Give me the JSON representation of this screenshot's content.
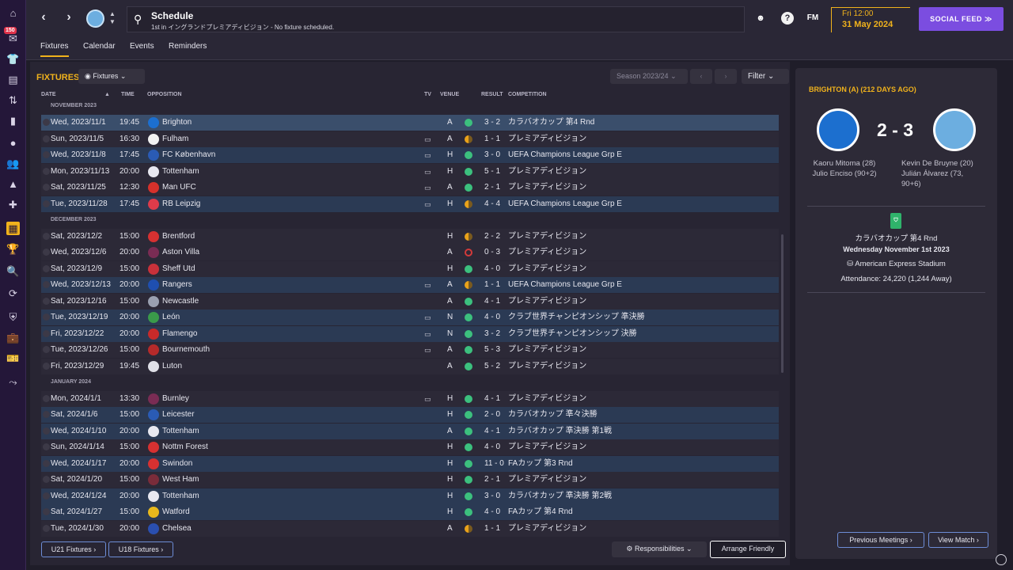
{
  "rail": {
    "badge": "150"
  },
  "header": {
    "title": "Schedule",
    "subtitle": "1st in イングランドプレミアディビジョン - No fixture scheduled.",
    "brand": "FM",
    "date_day": "Fri 12:00",
    "date_full": "31 May 2024",
    "social_feed": "SOCIAL FEED ≫"
  },
  "tabs": [
    "Fixtures",
    "Calendar",
    "Events",
    "Reminders"
  ],
  "fixtures": {
    "heading": "FIXTURES",
    "view_select": "Fixtures",
    "season": "Season 2023/24",
    "filter": "Filter",
    "columns": {
      "date": "DATE",
      "time": "TIME",
      "opposition": "OPPOSITION",
      "tv": "TV",
      "venue": "VENUE",
      "result": "RESULT",
      "competition": "COMPETITION"
    },
    "months": [
      {
        "label": "NOVEMBER 2023",
        "rows": [
          {
            "date": "Wed, 2023/11/1",
            "time": "19:45",
            "opp": "Brighton",
            "tv": false,
            "venue": "A",
            "outcome": "w",
            "score": "3 - 2",
            "comp": "カラバオカップ 第4 Rnd",
            "style": "hl",
            "crest": "#1c6fcf"
          },
          {
            "date": "Sun, 2023/11/5",
            "time": "16:30",
            "opp": "Fulham",
            "tv": true,
            "venue": "A",
            "outcome": "d",
            "score": "1 - 1",
            "comp": "プレミアディビジョン",
            "style": "",
            "crest": "#f2f2f2"
          },
          {
            "date": "Wed, 2023/11/8",
            "time": "17:45",
            "opp": "FC København",
            "tv": true,
            "venue": "H",
            "outcome": "w",
            "score": "3 - 0",
            "comp": "UEFA Champions League Grp E",
            "style": "cup",
            "crest": "#2a5bb5"
          },
          {
            "date": "Mon, 2023/11/13",
            "time": "20:00",
            "opp": "Tottenham",
            "tv": true,
            "venue": "H",
            "outcome": "w",
            "score": "5 - 1",
            "comp": "プレミアディビジョン",
            "style": "",
            "crest": "#e8e8f0"
          },
          {
            "date": "Sat, 2023/11/25",
            "time": "12:30",
            "opp": "Man UFC",
            "tv": true,
            "venue": "A",
            "outcome": "w",
            "score": "2 - 1",
            "comp": "プレミアディビジョン",
            "style": "",
            "crest": "#d6312b"
          },
          {
            "date": "Tue, 2023/11/28",
            "time": "17:45",
            "opp": "RB Leipzig",
            "tv": true,
            "venue": "H",
            "outcome": "d",
            "score": "4 - 4",
            "comp": "UEFA Champions League Grp E",
            "style": "cup",
            "crest": "#dd3b4a"
          }
        ]
      },
      {
        "label": "DECEMBER 2023",
        "rows": [
          {
            "date": "Sat, 2023/12/2",
            "time": "15:00",
            "opp": "Brentford",
            "tv": false,
            "venue": "H",
            "outcome": "d",
            "score": "2 - 2",
            "comp": "プレミアディビジョン",
            "style": "",
            "crest": "#d63131"
          },
          {
            "date": "Wed, 2023/12/6",
            "time": "20:00",
            "opp": "Aston Villa",
            "tv": false,
            "venue": "A",
            "outcome": "l",
            "score": "0 - 3",
            "comp": "プレミアディビジョン",
            "style": "",
            "crest": "#7a2c54"
          },
          {
            "date": "Sat, 2023/12/9",
            "time": "15:00",
            "opp": "Sheff Utd",
            "tv": false,
            "venue": "H",
            "outcome": "w",
            "score": "4 - 0",
            "comp": "プレミアディビジョン",
            "style": "",
            "crest": "#c8313a"
          },
          {
            "date": "Wed, 2023/12/13",
            "time": "20:00",
            "opp": "Rangers",
            "tv": true,
            "venue": "A",
            "outcome": "d",
            "score": "1 - 1",
            "comp": "UEFA Champions League Grp E",
            "style": "cup",
            "crest": "#1f4fb0"
          },
          {
            "date": "Sat, 2023/12/16",
            "time": "15:00",
            "opp": "Newcastle",
            "tv": false,
            "venue": "A",
            "outcome": "w",
            "score": "4 - 1",
            "comp": "プレミアディビジョン",
            "style": "",
            "crest": "#9aa0b0"
          },
          {
            "date": "Tue, 2023/12/19",
            "time": "20:00",
            "opp": "León",
            "tv": true,
            "venue": "N",
            "outcome": "w",
            "score": "4 - 0",
            "comp": "クラブ世界チャンピオンシップ 準決勝",
            "style": "cup",
            "crest": "#3a9a4a"
          },
          {
            "date": "Fri, 2023/12/22",
            "time": "20:00",
            "opp": "Flamengo",
            "tv": true,
            "venue": "N",
            "outcome": "w",
            "score": "3 - 2",
            "comp": "クラブ世界チャンピオンシップ 決勝",
            "style": "cup",
            "crest": "#c72a2a"
          },
          {
            "date": "Tue, 2023/12/26",
            "time": "15:00",
            "opp": "Bournemouth",
            "tv": true,
            "venue": "A",
            "outcome": "w",
            "score": "5 - 3",
            "comp": "プレミアディビジョン",
            "style": "",
            "crest": "#b52a2a"
          },
          {
            "date": "Fri, 2023/12/29",
            "time": "19:45",
            "opp": "Luton",
            "tv": false,
            "venue": "A",
            "outcome": "w",
            "score": "5 - 2",
            "comp": "プレミアディビジョン",
            "style": "",
            "crest": "#e0e0e8"
          }
        ]
      },
      {
        "label": "JANUARY 2024",
        "rows": [
          {
            "date": "Mon, 2024/1/1",
            "time": "13:30",
            "opp": "Burnley",
            "tv": true,
            "venue": "H",
            "outcome": "w",
            "score": "4 - 1",
            "comp": "プレミアディビジョン",
            "style": "",
            "crest": "#7a2c54"
          },
          {
            "date": "Sat, 2024/1/6",
            "time": "15:00",
            "opp": "Leicester",
            "tv": false,
            "venue": "H",
            "outcome": "w",
            "score": "2 - 0",
            "comp": "カラバオカップ 準々決勝",
            "style": "cup",
            "crest": "#2a5bb5"
          },
          {
            "date": "Wed, 2024/1/10",
            "time": "20:00",
            "opp": "Tottenham",
            "tv": false,
            "venue": "A",
            "outcome": "w",
            "score": "4 - 1",
            "comp": "カラバオカップ 準決勝 第1戦",
            "style": "cup",
            "crest": "#e8e8f0"
          },
          {
            "date": "Sun, 2024/1/14",
            "time": "15:00",
            "opp": "Nottm Forest",
            "tv": false,
            "venue": "H",
            "outcome": "w",
            "score": "4 - 0",
            "comp": "プレミアディビジョン",
            "style": "",
            "crest": "#d63131"
          },
          {
            "date": "Wed, 2024/1/17",
            "time": "20:00",
            "opp": "Swindon",
            "tv": false,
            "venue": "H",
            "outcome": "w",
            "score": "11 - 0",
            "comp": "FAカップ 第3 Rnd",
            "style": "cup",
            "crest": "#d63131"
          },
          {
            "date": "Sat, 2024/1/20",
            "time": "15:00",
            "opp": "West Ham",
            "tv": false,
            "venue": "H",
            "outcome": "w",
            "score": "2 - 1",
            "comp": "プレミアディビジョン",
            "style": "",
            "crest": "#7a2c3a"
          },
          {
            "date": "Wed, 2024/1/24",
            "time": "20:00",
            "opp": "Tottenham",
            "tv": false,
            "venue": "H",
            "outcome": "w",
            "score": "3 - 0",
            "comp": "カラバオカップ 準決勝 第2戦",
            "style": "cup",
            "crest": "#e8e8f0"
          },
          {
            "date": "Sat, 2024/1/27",
            "time": "15:00",
            "opp": "Watford",
            "tv": false,
            "venue": "H",
            "outcome": "w",
            "score": "4 - 0",
            "comp": "FAカップ 第4 Rnd",
            "style": "cup",
            "crest": "#e8b81c"
          },
          {
            "date": "Tue, 2024/1/30",
            "time": "20:00",
            "opp": "Chelsea",
            "tv": false,
            "venue": "A",
            "outcome": "d",
            "score": "1 - 1",
            "comp": "プレミアディビジョン",
            "style": "",
            "crest": "#2a4fb0"
          }
        ]
      }
    ],
    "u21": "U21 Fixtures ›",
    "u18": "U18 Fixtures ›",
    "responsibilities": "Responsibilities",
    "arrange_friendly": "Arrange Friendly"
  },
  "detail": {
    "title": "BRIGHTON (A) (212 DAYS AGO)",
    "score": "2 - 3",
    "home_scorers": [
      "Kaoru Mitoma (28)",
      "Julio Enciso (90+2)"
    ],
    "away_scorers": [
      "Kevin De Bruyne (20)",
      "Julián Álvarez (73,",
      "90+6)"
    ],
    "competition": "カラバオカップ 第4 Rnd",
    "match_date": "Wednesday November 1st 2023",
    "stadium": "American Express Stadium",
    "attendance": "Attendance: 24,220 (1,244 Away)",
    "previous_meetings": "Previous Meetings ›",
    "view_match": "View Match ›"
  }
}
